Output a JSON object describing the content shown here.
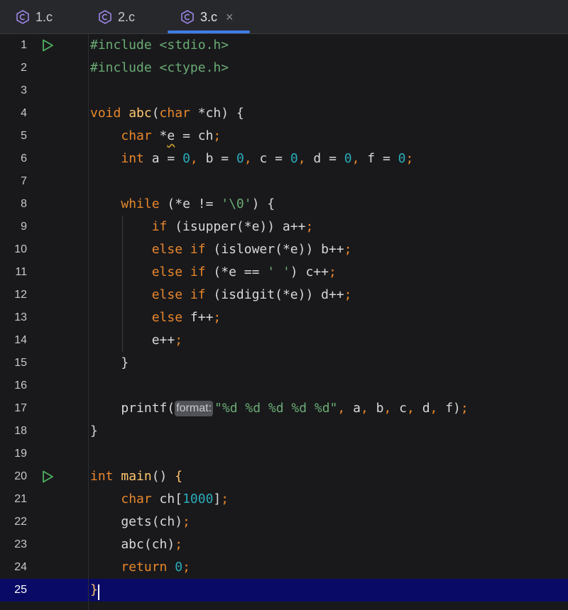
{
  "tabs": [
    {
      "label": "1.c",
      "icon": "c-file-icon",
      "active": false
    },
    {
      "label": "2.c",
      "icon": "c-file-icon",
      "active": false
    },
    {
      "label": "3.c",
      "icon": "c-file-icon",
      "active": true,
      "close": "×"
    }
  ],
  "editor": {
    "current_line": 25,
    "lines": [
      {
        "n": "1",
        "run": true,
        "tokens": [
          [
            "pre",
            "#include "
          ],
          [
            "str",
            "<stdio.h>"
          ]
        ]
      },
      {
        "n": "2",
        "tokens": [
          [
            "pre",
            "#include "
          ],
          [
            "str",
            "<ctype.h>"
          ]
        ]
      },
      {
        "n": "3",
        "tokens": []
      },
      {
        "n": "4",
        "tokens": [
          [
            "kw",
            "void "
          ],
          [
            "fn",
            "abc"
          ],
          [
            "plain",
            "("
          ],
          [
            "kw",
            "char "
          ],
          [
            "plain",
            "*ch) {"
          ]
        ]
      },
      {
        "n": "5",
        "tokens": [
          [
            "plain",
            "    "
          ],
          [
            "kw",
            "char "
          ],
          [
            "plain",
            "*"
          ],
          [
            "squig",
            "e"
          ],
          [
            "plain",
            " = ch"
          ],
          [
            "punc",
            ";"
          ]
        ]
      },
      {
        "n": "6",
        "tokens": [
          [
            "plain",
            "    "
          ],
          [
            "kw",
            "int "
          ],
          [
            "plain",
            "a = "
          ],
          [
            "num",
            "0"
          ],
          [
            "punc",
            ", "
          ],
          [
            "plain",
            "b = "
          ],
          [
            "num",
            "0"
          ],
          [
            "punc",
            ", "
          ],
          [
            "plain",
            "c = "
          ],
          [
            "num",
            "0"
          ],
          [
            "punc",
            ", "
          ],
          [
            "plain",
            "d = "
          ],
          [
            "num",
            "0"
          ],
          [
            "punc",
            ", "
          ],
          [
            "plain",
            "f = "
          ],
          [
            "num",
            "0"
          ],
          [
            "punc",
            ";"
          ]
        ]
      },
      {
        "n": "7",
        "tokens": []
      },
      {
        "n": "8",
        "tokens": [
          [
            "plain",
            "    "
          ],
          [
            "kw",
            "while "
          ],
          [
            "plain",
            "(*e != "
          ],
          [
            "str",
            "'\\0'"
          ],
          [
            "plain",
            ") {"
          ]
        ]
      },
      {
        "n": "9",
        "tokens": [
          [
            "plain",
            "        "
          ],
          [
            "kw",
            "if "
          ],
          [
            "plain",
            "(isupper(*e)) a++"
          ],
          [
            "punc",
            ";"
          ]
        ]
      },
      {
        "n": "10",
        "tokens": [
          [
            "plain",
            "        "
          ],
          [
            "kw",
            "else if "
          ],
          [
            "plain",
            "(islower(*e)) b++"
          ],
          [
            "punc",
            ";"
          ]
        ]
      },
      {
        "n": "11",
        "tokens": [
          [
            "plain",
            "        "
          ],
          [
            "kw",
            "else if "
          ],
          [
            "plain",
            "(*e == "
          ],
          [
            "str",
            "' '"
          ],
          [
            "plain",
            ") c++"
          ],
          [
            "punc",
            ";"
          ]
        ]
      },
      {
        "n": "12",
        "tokens": [
          [
            "plain",
            "        "
          ],
          [
            "kw",
            "else if "
          ],
          [
            "plain",
            "(isdigit(*e)) d++"
          ],
          [
            "punc",
            ";"
          ]
        ]
      },
      {
        "n": "13",
        "tokens": [
          [
            "plain",
            "        "
          ],
          [
            "kw",
            "else "
          ],
          [
            "plain",
            "f++"
          ],
          [
            "punc",
            ";"
          ]
        ]
      },
      {
        "n": "14",
        "tokens": [
          [
            "plain",
            "        e++"
          ],
          [
            "punc",
            ";"
          ]
        ]
      },
      {
        "n": "15",
        "tokens": [
          [
            "plain",
            "    }"
          ]
        ]
      },
      {
        "n": "16",
        "tokens": []
      },
      {
        "n": "17",
        "tokens": [
          [
            "plain",
            "    printf("
          ],
          [
            "hint",
            "format:"
          ],
          [
            "str",
            "\"%d %d %d %d %d\""
          ],
          [
            "punc",
            ", "
          ],
          [
            "plain",
            "a"
          ],
          [
            "punc",
            ", "
          ],
          [
            "plain",
            "b"
          ],
          [
            "punc",
            ", "
          ],
          [
            "plain",
            "c"
          ],
          [
            "punc",
            ", "
          ],
          [
            "plain",
            "d"
          ],
          [
            "punc",
            ", "
          ],
          [
            "plain",
            "f)"
          ],
          [
            "punc",
            ";"
          ]
        ]
      },
      {
        "n": "18",
        "tokens": [
          [
            "plain",
            "}"
          ]
        ]
      },
      {
        "n": "19",
        "tokens": []
      },
      {
        "n": "20",
        "run": true,
        "tokens": [
          [
            "kw",
            "int "
          ],
          [
            "fn",
            "main"
          ],
          [
            "plain",
            "() "
          ],
          [
            "fn",
            "{"
          ]
        ]
      },
      {
        "n": "21",
        "tokens": [
          [
            "plain",
            "    "
          ],
          [
            "kw",
            "char "
          ],
          [
            "plain",
            "ch["
          ],
          [
            "num",
            "1000"
          ],
          [
            "plain",
            "]"
          ],
          [
            "punc",
            ";"
          ]
        ]
      },
      {
        "n": "22",
        "tokens": [
          [
            "plain",
            "    gets(ch)"
          ],
          [
            "punc",
            ";"
          ]
        ]
      },
      {
        "n": "23",
        "tokens": [
          [
            "plain",
            "    abc(ch)"
          ],
          [
            "punc",
            ";"
          ]
        ]
      },
      {
        "n": "24",
        "tokens": [
          [
            "plain",
            "    "
          ],
          [
            "kw",
            "return "
          ],
          [
            "num",
            "0"
          ],
          [
            "punc",
            ";"
          ]
        ]
      },
      {
        "n": "25",
        "tokens": [
          [
            "fn",
            "}"
          ]
        ]
      }
    ]
  }
}
